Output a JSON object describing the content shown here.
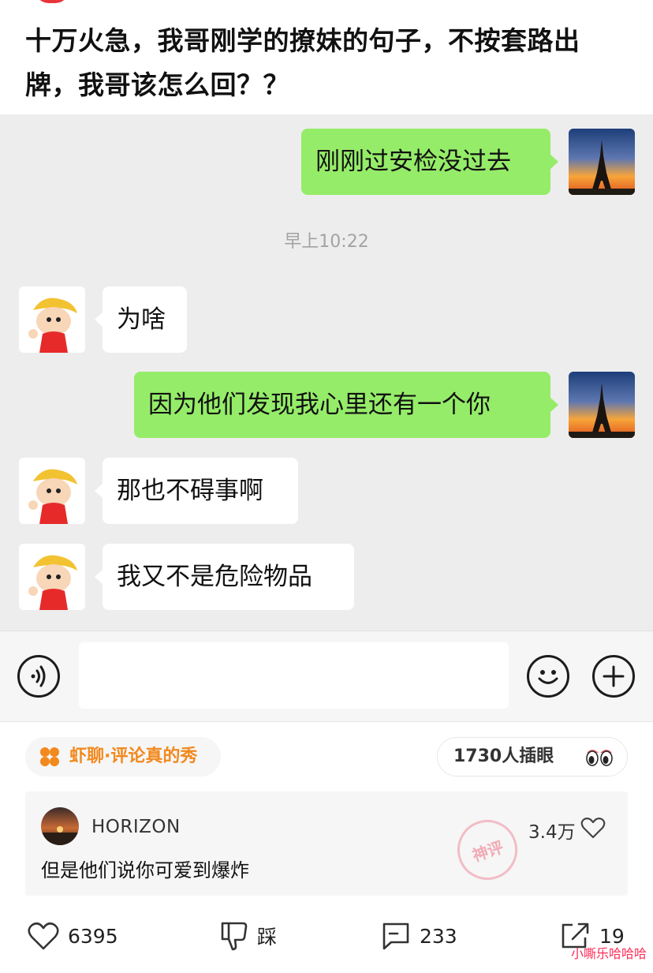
{
  "post": {
    "title": "十万火急，我哥刚学的撩妹的句子，不按套路出牌，我哥该怎么回？？"
  },
  "chat": {
    "timestamp": "早上10:22",
    "messages": [
      {
        "side": "me",
        "text": "刚刚过安检没过去"
      },
      {
        "side": "them",
        "text": "为啥"
      },
      {
        "side": "me",
        "text": "因为他们发现我心里还有一个你"
      },
      {
        "side": "them",
        "text": "那也不碍事啊"
      },
      {
        "side": "them",
        "text": "我又不是危险物品"
      }
    ],
    "icons": {
      "voice": "voice-icon",
      "emoji": "emoji-icon",
      "plus": "plus-icon"
    }
  },
  "topic": {
    "label": "虾聊·评论真的秀",
    "accent": "#f2891e"
  },
  "views": {
    "label": "1730人插眼"
  },
  "top_comment": {
    "username": "HORIZON",
    "likes": "3.4万",
    "text": "但是他们说你可爱到爆炸",
    "stamp_text": "神评"
  },
  "actions": {
    "like_count": "6395",
    "dislike_label": "踩",
    "comment_count": "233",
    "share_count": "19"
  },
  "watermark": "小嘶乐哈哈哈"
}
